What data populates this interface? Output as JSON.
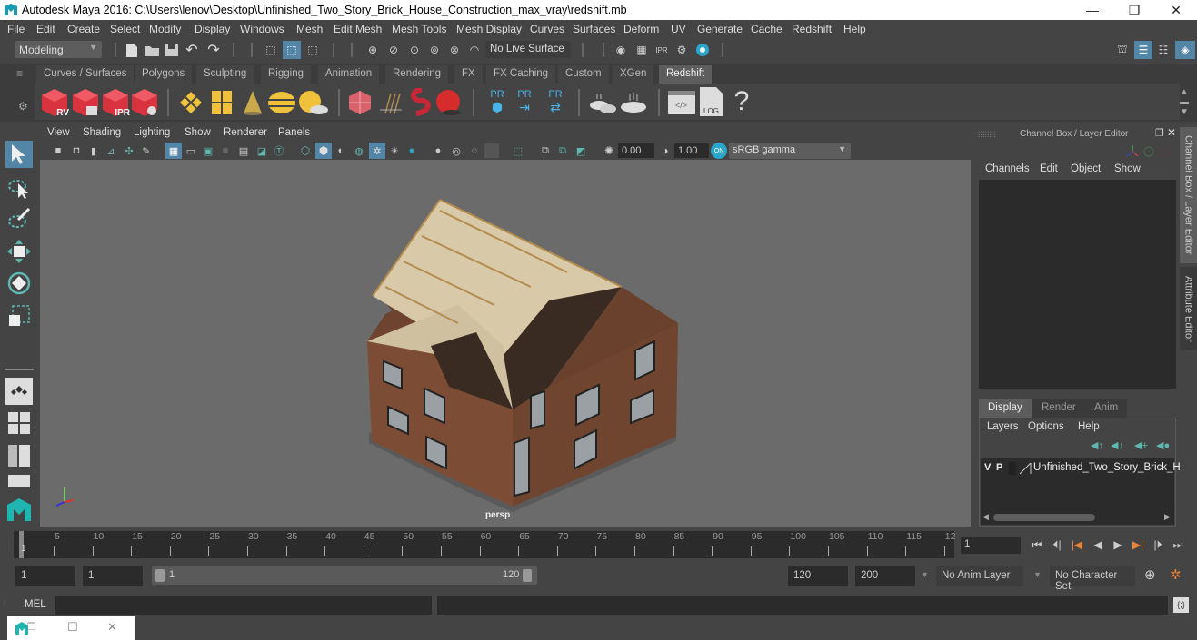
{
  "window": {
    "title": "Autodesk Maya 2016: C:\\Users\\lenov\\Desktop\\Unfinished_Two_Story_Brick_House_Construction_max_vray\\redshift.mb",
    "minimize": "—",
    "restore": "❐",
    "close": "✕"
  },
  "menubar": {
    "items": [
      "File",
      "Edit",
      "Create",
      "Select",
      "Modify",
      "Display",
      "Windows",
      "Mesh",
      "Edit Mesh",
      "Mesh Tools",
      "Mesh Display",
      "Curves",
      "Surfaces",
      "Deform",
      "UV",
      "Generate",
      "Cache",
      "Redshift",
      "Help"
    ]
  },
  "statusline": {
    "mode": "Modeling",
    "live_surface": "No Live Surface"
  },
  "shelf": {
    "tabs": [
      "Curves / Surfaces",
      "Polygons",
      "Sculpting",
      "Rigging",
      "Animation",
      "Rendering",
      "FX",
      "FX Caching",
      "Custom",
      "XGen",
      "Redshift"
    ],
    "active_tab": "Redshift",
    "icons": [
      {
        "name": "rv-render-view-icon",
        "label": "RV"
      },
      {
        "name": "batch-render-icon",
        "label": ""
      },
      {
        "name": "ipr-render-icon",
        "label": "IPR"
      },
      {
        "name": "render-settings-icon",
        "label": ""
      },
      {
        "name": "light-portal-icon",
        "label": ""
      },
      {
        "name": "area-light-icon",
        "label": ""
      },
      {
        "name": "spot-light-icon",
        "label": ""
      },
      {
        "name": "dome-light-icon",
        "label": ""
      },
      {
        "name": "sun-sky-icon",
        "label": ""
      },
      {
        "name": "proxy-icon",
        "label": ""
      },
      {
        "name": "hair-icon",
        "label": ""
      },
      {
        "name": "volume-icon",
        "label": ""
      },
      {
        "name": "sphere-material-icon",
        "label": ""
      },
      {
        "name": "pr-create-icon",
        "label": "PR"
      },
      {
        "name": "pr-export-icon",
        "label": "PR"
      },
      {
        "name": "pr-swap-icon",
        "label": "PR"
      },
      {
        "name": "bake-multi-icon",
        "label": ""
      },
      {
        "name": "bake-single-icon",
        "label": ""
      },
      {
        "name": "script-editor-icon",
        "label": ""
      },
      {
        "name": "log-icon",
        "label": "LOG"
      },
      {
        "name": "help-icon",
        "label": "?"
      }
    ]
  },
  "viewport": {
    "menu": [
      "View",
      "Shading",
      "Lighting",
      "Show",
      "Renderer",
      "Panels"
    ],
    "exposure": "0.00",
    "gamma": "1.00",
    "color_space": "sRGB gamma",
    "camera_label": "persp"
  },
  "channelbox": {
    "title": "Channel Box / Layer Editor",
    "menu": [
      "Channels",
      "Edit",
      "Object",
      "Show"
    ],
    "side_tabs": [
      "Channel Box / Layer Editor",
      "Attribute Editor"
    ]
  },
  "layer_editor": {
    "tabs": [
      "Display",
      "Render",
      "Anim"
    ],
    "active_tab": "Display",
    "menu": [
      "Layers",
      "Options",
      "Help"
    ],
    "layers": [
      {
        "v": "V",
        "p": "P",
        "name": "Unfinished_Two_Story_Brick_H"
      }
    ]
  },
  "timeline": {
    "start_label": "1",
    "ticks": [
      "5",
      "10",
      "15",
      "20",
      "25",
      "30",
      "35",
      "40",
      "45",
      "50",
      "55",
      "60",
      "65",
      "70",
      "75",
      "80",
      "85",
      "90",
      "95",
      "100",
      "105",
      "110",
      "115",
      "12"
    ],
    "current_frame": "1"
  },
  "range": {
    "start": "1",
    "playback_start": "1",
    "slider_start": "1",
    "slider_end": "120",
    "playback_end": "120",
    "end": "200",
    "anim_layer": "No Anim Layer",
    "character_set": "No Character Set"
  },
  "cmdline": {
    "label": "MEL"
  },
  "colors": {
    "accent": "#5285a6",
    "background": "#444444",
    "viewport": "#6b6b6b",
    "field": "#2b2b2b"
  }
}
